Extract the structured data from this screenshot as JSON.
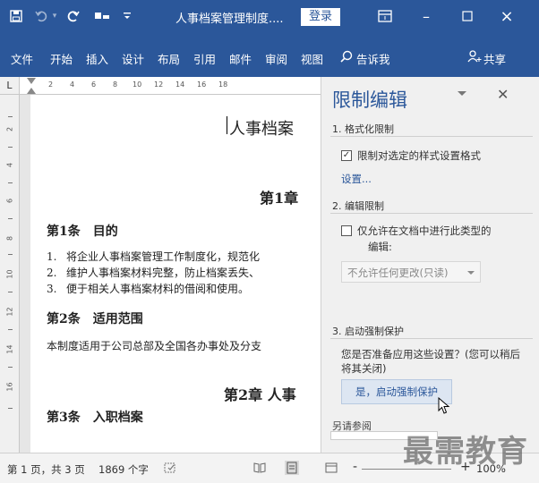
{
  "title_bar": {
    "doc_title": "人事档案管理制度....",
    "login": "登录",
    "minimize": "–",
    "close": "×"
  },
  "ribbon": {
    "tabs": [
      "文件",
      "开始",
      "插入",
      "设计",
      "布局",
      "引用",
      "邮件",
      "审阅",
      "视图"
    ],
    "tell_me": "告诉我",
    "share": "共享"
  },
  "ruler": {
    "corner": "L",
    "h_ticks": [
      "2",
      "4",
      "6",
      "8",
      "10",
      "12",
      "14",
      "16",
      "18"
    ],
    "v_ticks": [
      "2",
      "1",
      "4",
      "1",
      "6",
      "1",
      "8",
      "1",
      "10",
      "1",
      "12",
      "1",
      "14",
      "1",
      "16"
    ]
  },
  "document": {
    "title": "人事档案",
    "chapter1": "第1章",
    "article1_heading": "第1条　目的",
    "list": [
      {
        "num": "1.",
        "text": "将企业人事档案管理工作制度化，规范化"
      },
      {
        "num": "2.",
        "text": "维护人事档案材料完整，防止档案丢失、"
      },
      {
        "num": "3.",
        "text": "便于相关人事档案材料的借阅和使用。"
      }
    ],
    "article2_heading": "第2条　适用范围",
    "scope_text": "本制度适用于公司总部及全国各办事处及分支",
    "chapter2": "第2章 人事",
    "article3_heading": "第3条　入职档案"
  },
  "panel": {
    "title": "限制编辑",
    "section1": "1. 格式化限制",
    "check1_label": "限制对选定的样式设置格式",
    "check1_mark": "✓",
    "settings_link": "设置...",
    "section2": "2. 编辑限制",
    "check2_label_line1": "仅允许在文档中进行此类型的",
    "check2_label_line2": "编辑:",
    "select_value": "不允许任何更改(只读)",
    "section3": "3. 启动强制保护",
    "ask_text": "您是否准备应用这些设置？(您可以稍后将其关闭)",
    "yes_button": "是，启动强制保护",
    "also": "另请参阅"
  },
  "status_bar": {
    "page": "第 1 页，共 3 页",
    "words": "1869 个字",
    "zoom_minus": "-",
    "zoom_plus": "+",
    "zoom": "100%"
  },
  "watermark": "最需教育",
  "colors": {
    "accent": "#2b579a"
  }
}
